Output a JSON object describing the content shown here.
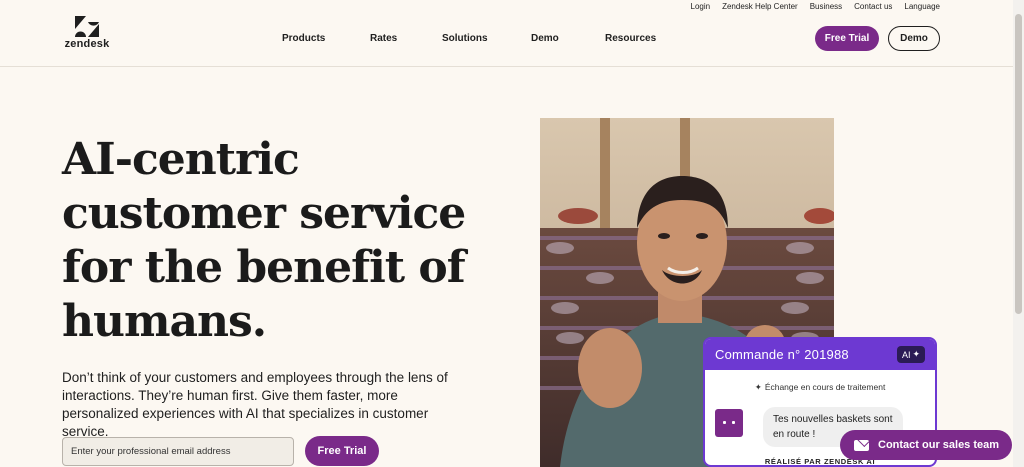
{
  "utility_nav": [
    "Login",
    "Zendesk Help Center",
    "Business",
    "Contact us",
    "Language"
  ],
  "logo": {
    "word": "zendesk",
    "icon": "zendesk-z-logo"
  },
  "main_nav": [
    "Products",
    "Rates",
    "Solutions",
    "Demo",
    "Resources"
  ],
  "header_buttons": {
    "free_trial": "Free Trial",
    "demo": "Demo"
  },
  "hero": {
    "headline_lines": [
      "AI-centric",
      "customer service",
      "for the benefit of",
      "humans."
    ],
    "subheadline": "Don’t think of your customers and employees through the lens of interactions. They’re human first. Give them faster, more personalized experiences with AI that specializes in customer service.",
    "email_placeholder": "Enter your professional email address",
    "cta": "Free Trial"
  },
  "chat_card": {
    "title": "Commande n° 201988",
    "ai_badge": "AI",
    "status": "Échange en cours de traitement",
    "message": "Tes nouvelles baskets sont en route !",
    "powered_by": "RÉALISÉ PAR ZENDESK AI"
  },
  "contact_sales": "Contact our sales team",
  "colors": {
    "brand_purple": "#7a2a89",
    "card_purple": "#6d39d2",
    "background": "#fcf8f2"
  }
}
